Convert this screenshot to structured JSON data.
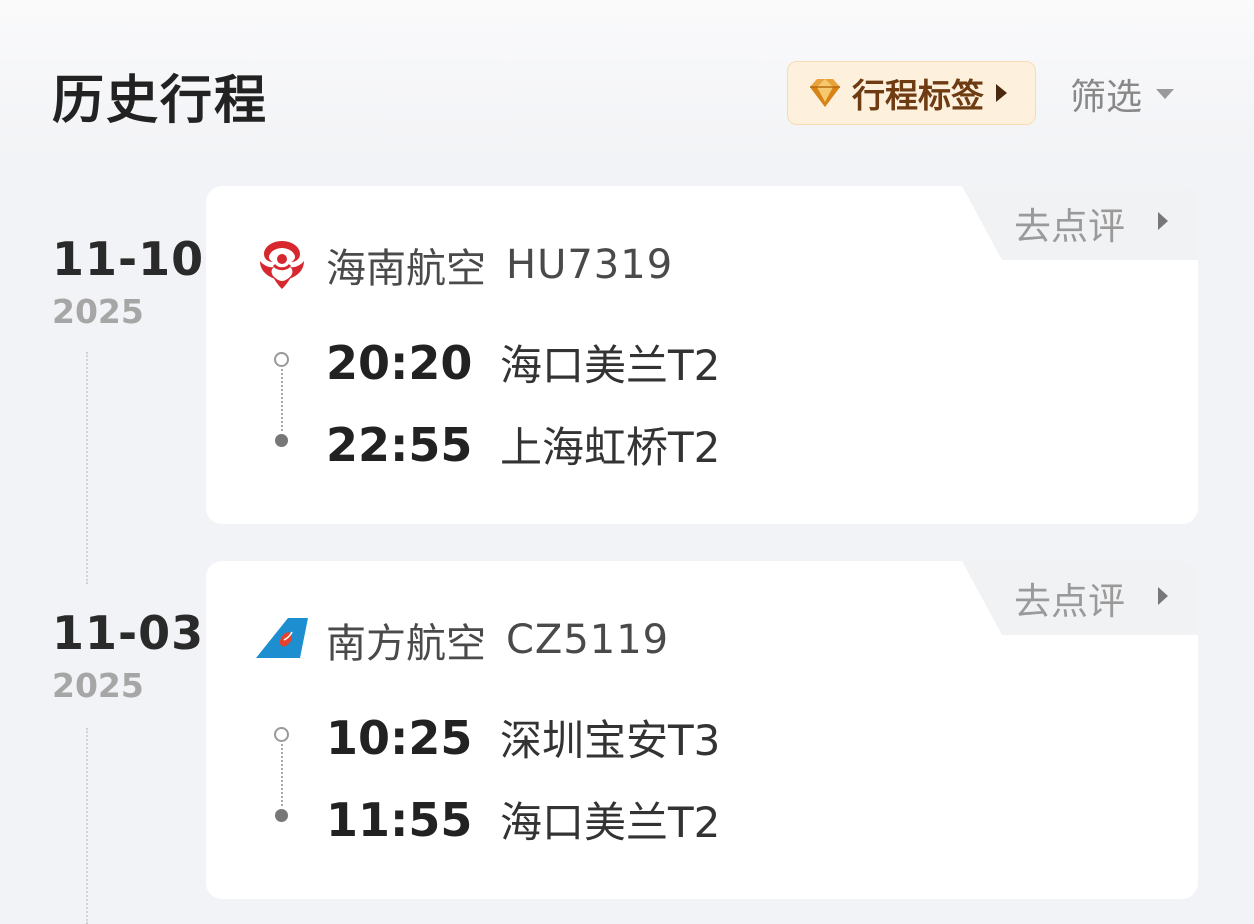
{
  "header": {
    "title": "历史行程",
    "tag_button_label": "行程标签",
    "filter_label": "筛选"
  },
  "trips": [
    {
      "date": "11-10",
      "year": "2025",
      "review_label": "去点评",
      "airline": "海南航空",
      "flight_no": "HU7319",
      "logo": "hainan-airlines-logo",
      "depart_time": "20:20",
      "depart_airport": "海口美兰T2",
      "arrive_time": "22:55",
      "arrive_airport": "上海虹桥T2"
    },
    {
      "date": "11-03",
      "year": "2025",
      "review_label": "去点评",
      "airline": "南方航空",
      "flight_no": "CZ5119",
      "logo": "china-southern-logo",
      "depart_time": "10:25",
      "depart_airport": "深圳宝安T3",
      "arrive_time": "11:55",
      "arrive_airport": "海口美兰T2"
    }
  ],
  "colors": {
    "tag_bg": "#fdf0dc",
    "tag_text": "#6e3b12",
    "hainan_red": "#d7282f",
    "southern_blue": "#1d8fd0"
  }
}
